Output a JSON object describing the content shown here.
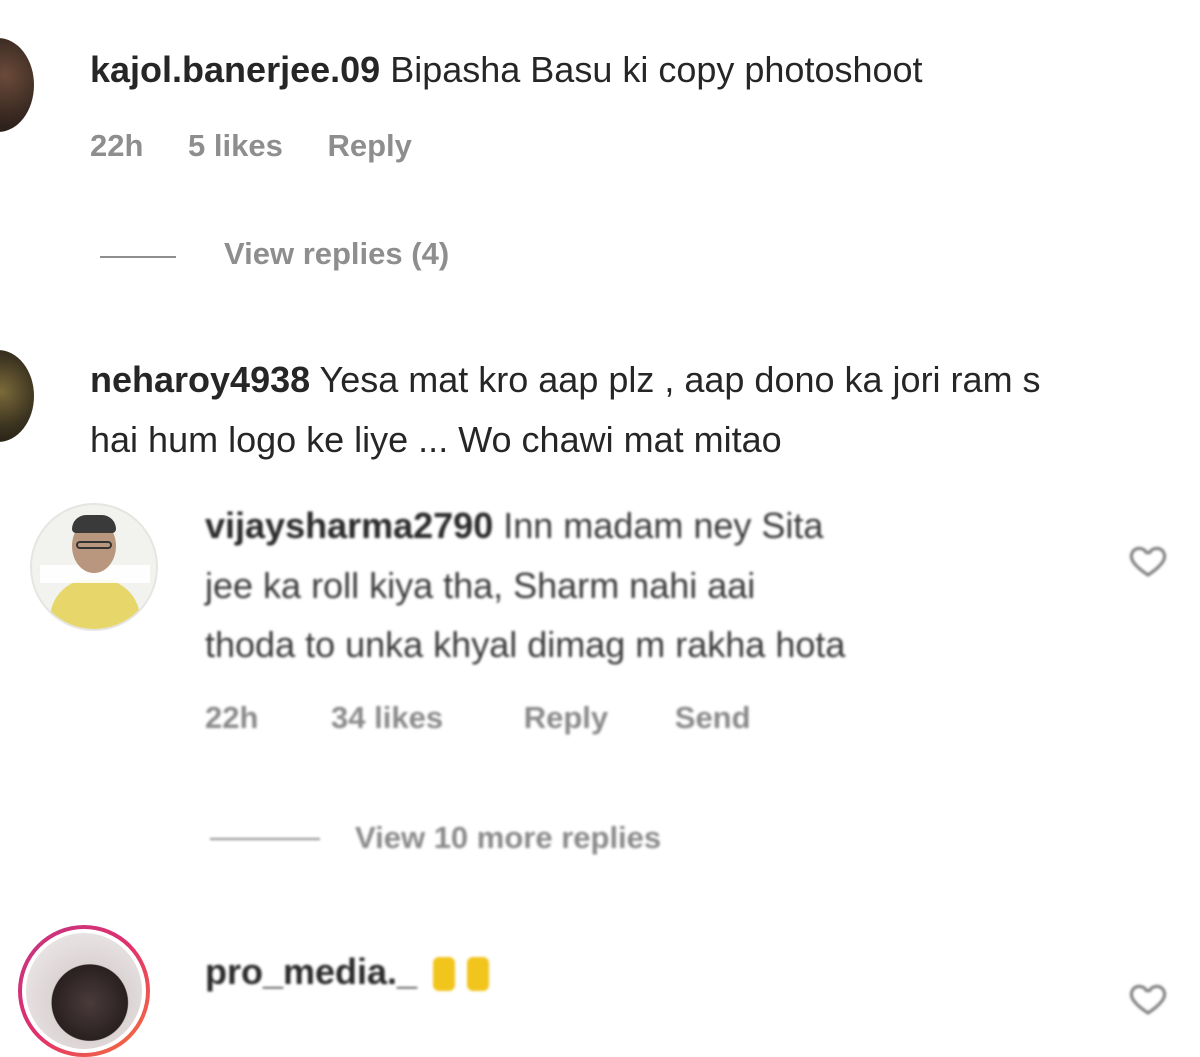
{
  "comments": [
    {
      "username": "kajol.banerjee.09",
      "text": "Bipasha Basu ki copy photoshoot",
      "time": "22h",
      "likes": "5 likes",
      "reply": "Reply",
      "view_replies": "View replies (4)"
    },
    {
      "username": "neharoy4938",
      "text_line1": "Yesa mat kro aap plz , aap dono ka jori ram s",
      "text_line2": "hai hum logo ke liye ... Wo chawi mat mitao"
    }
  ],
  "reply": {
    "username": "vijaysharma2790",
    "text_line1": "Inn madam ney Sita",
    "text_line2": "jee ka roll kiya tha, Sharm nahi aai",
    "text_line3": "thoda to unka khyal dimag m rakha hota",
    "time": "22h",
    "likes": "34 likes",
    "reply": "Reply",
    "send": "Send",
    "view_more": "View 10 more replies"
  },
  "last_comment": {
    "username": "pro_media._",
    "emoji": "raised-hands-emoji"
  },
  "colors": {
    "text": "#262626",
    "meta": "#8e8e8e",
    "story_ring": "#e1306c"
  },
  "icons": [
    "heart-icon"
  ]
}
